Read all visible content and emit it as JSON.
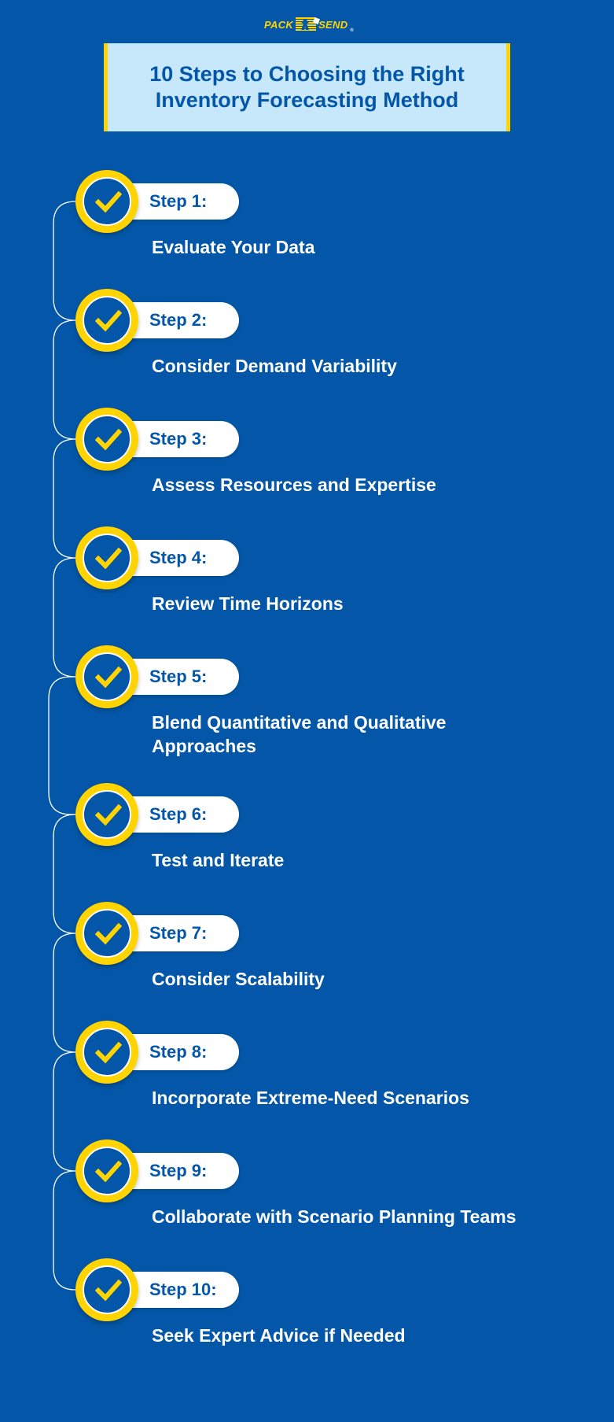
{
  "brand": {
    "logo_left": "PACK",
    "logo_right": "SEND",
    "registered": "®",
    "colors": {
      "background": "#0457a8",
      "accent": "#ffd400",
      "title_bg": "#c6e8fa",
      "text_dark": "#0457a8",
      "text_light": "#ffffff"
    }
  },
  "title": {
    "line1": "10 Steps to Choosing the Right",
    "line2": "Inventory Forecasting Method"
  },
  "steps": [
    {
      "label": "Step 1:",
      "text": "Evaluate Your Data",
      "icon": "check-icon"
    },
    {
      "label": "Step 2:",
      "text": "Consider Demand Variability",
      "icon": "check-icon"
    },
    {
      "label": "Step 3:",
      "text": "Assess Resources and Expertise",
      "icon": "check-icon"
    },
    {
      "label": "Step 4:",
      "text": "Review Time Horizons",
      "icon": "check-icon"
    },
    {
      "label": "Step 5:",
      "text": "Blend Quantitative and Qualitative Approaches",
      "icon": "check-icon"
    },
    {
      "label": "Step 6:",
      "text": "Test and Iterate",
      "icon": "check-icon"
    },
    {
      "label": "Step 7:",
      "text": "Consider Scalability",
      "icon": "check-icon"
    },
    {
      "label": "Step 8:",
      "text": "Incorporate Extreme-Need Scenarios",
      "icon": "check-icon"
    },
    {
      "label": "Step 9:",
      "text": "Collaborate with Scenario Planning Teams",
      "icon": "check-icon"
    },
    {
      "label": "Step 10:",
      "text": "Seek Expert Advice if Needed",
      "icon": "check-icon"
    }
  ]
}
